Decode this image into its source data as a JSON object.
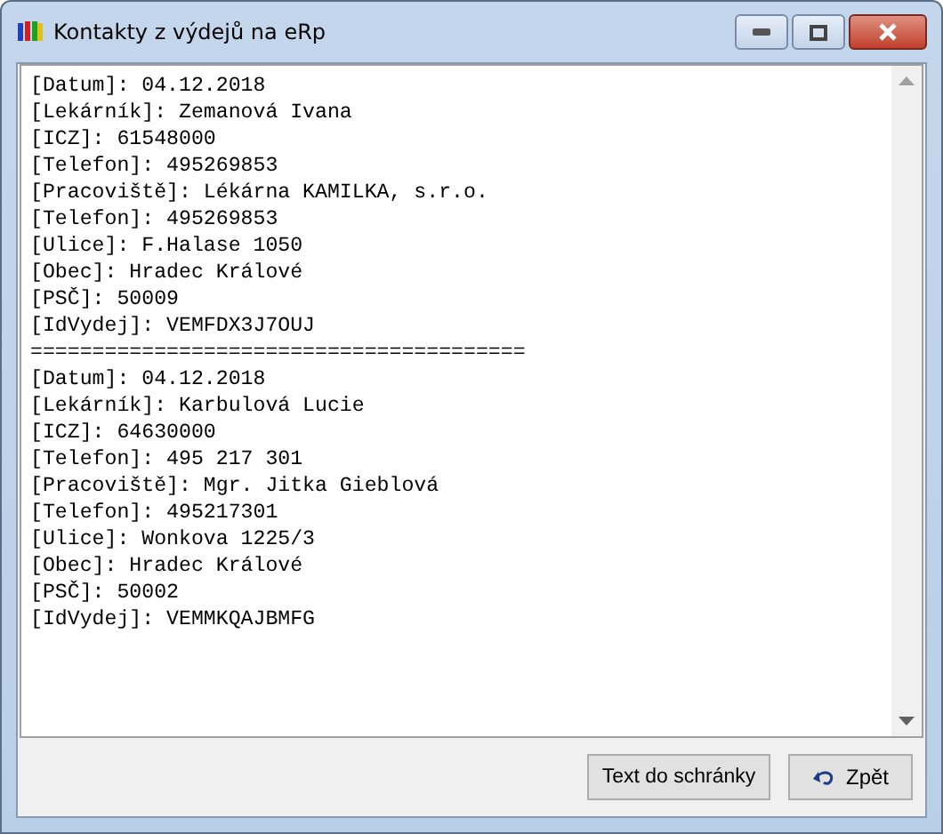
{
  "window": {
    "title": "Kontakty z výdejů na eRp"
  },
  "text_area": {
    "lines": [
      "[Datum]: 04.12.2018",
      "[Lekárník]: Zemanová Ivana",
      "[ICZ]: 61548000",
      "[Telefon]: 495269853",
      "[Pracoviště]: Lékárna KAMILKA, s.r.o.",
      "[Telefon]: 495269853",
      "[Ulice]: F.Halase 1050",
      "[Obec]: Hradec Králové",
      "[PSČ]: 50009",
      "[IdVydej]: VEMFDX3J7OUJ",
      "========================================",
      "[Datum]: 04.12.2018",
      "[Lekárník]: Karbulová Lucie",
      "[ICZ]: 64630000",
      "[Telefon]: 495 217 301",
      "[Pracoviště]: Mgr. Jitka Gieblová",
      "[Telefon]: 495217301",
      "[Ulice]: Wonkova 1225/3",
      "[Obec]: Hradec Králové",
      "[PSČ]: 50002",
      "[IdVydej]: VEMMKQAJBMFG"
    ]
  },
  "buttons": [
    {
      "label": "Text do schránky",
      "kind": "plain"
    },
    {
      "label": "Zpět",
      "kind": "back"
    }
  ]
}
